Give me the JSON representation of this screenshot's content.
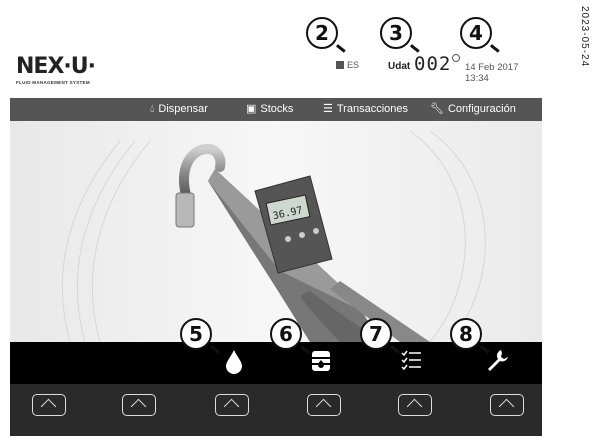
{
  "side_text": "2023-05-24",
  "header": {
    "logo_text": "NEX·U·",
    "logo_subtitle": "FLUID MANAGEMENT SYSTEM",
    "language": "ES",
    "user_label": "Udat",
    "user_number": "002",
    "datetime": "14 Feb 2017 13:34"
  },
  "callouts": [
    "2",
    "3",
    "4",
    "5",
    "6",
    "7",
    "8"
  ],
  "menu": {
    "items": [
      {
        "label": "Dispensar",
        "icon": "drop-icon"
      },
      {
        "label": "Stocks",
        "icon": "barrel-icon"
      },
      {
        "label": "Transacciones",
        "icon": "list-icon"
      },
      {
        "label": "Configuración",
        "icon": "wrench-icon"
      }
    ]
  },
  "meter_display": "36.97",
  "icon_bar": [
    {
      "icon": "drop-icon"
    },
    {
      "icon": "barrel-icon"
    },
    {
      "icon": "list-icon"
    },
    {
      "icon": "wrench-icon"
    }
  ],
  "softkeys": 6,
  "colors": {
    "menu_bg": "#555555",
    "icon_bar_bg": "#000000",
    "button_bar_bg": "#2a2a2a"
  }
}
